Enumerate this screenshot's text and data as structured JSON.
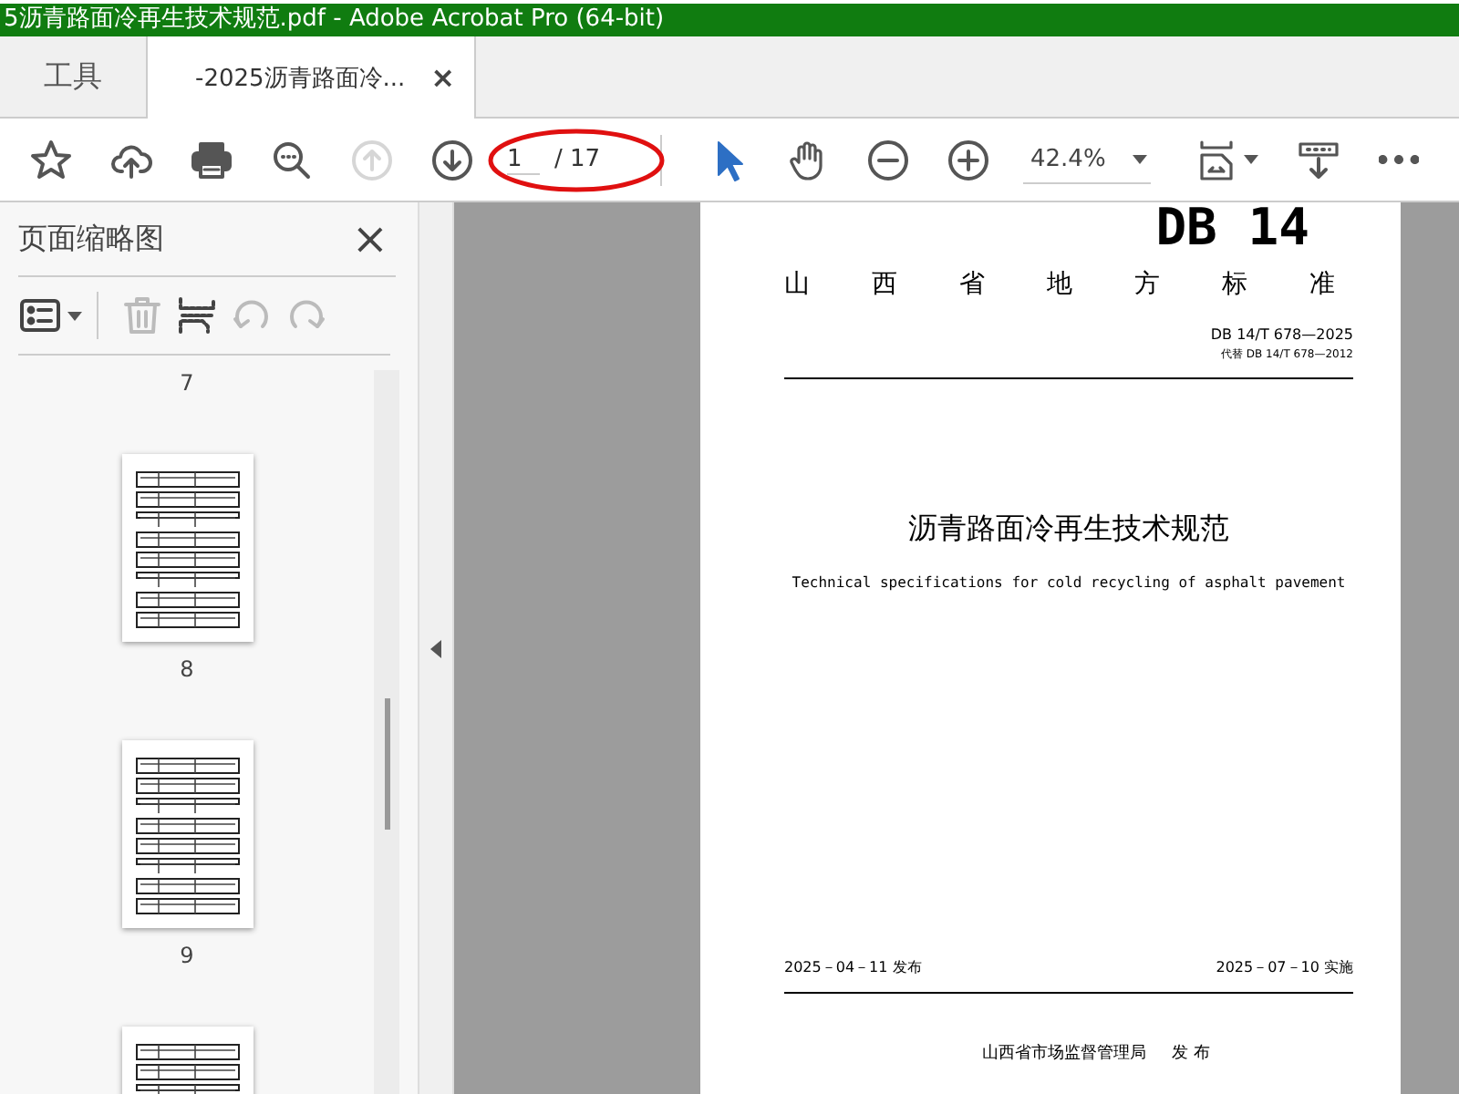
{
  "window": {
    "title": "5沥青路面冷再生技术规范.pdf - Adobe Acrobat Pro (64-bit)"
  },
  "tabs": [
    {
      "label": "工具",
      "selected": false
    },
    {
      "label": "-2025沥青路面冷...",
      "selected": true,
      "close": "×"
    }
  ],
  "toolbar": {
    "items": [
      {
        "kind": "bookmark",
        "disabled": false,
        "selected": false
      },
      {
        "kind": "upload",
        "disabled": false,
        "selected": false
      },
      {
        "kind": "print",
        "disabled": false,
        "selected": false
      },
      {
        "kind": "find",
        "disabled": false,
        "selected": false
      },
      {
        "kind": "prev",
        "disabled": true,
        "selected": false
      },
      {
        "kind": "next",
        "disabled": false,
        "selected": false
      },
      {
        "kind": "page_field",
        "value": "1",
        "total": "/ 17"
      },
      {
        "kind": "pointer",
        "disabled": false,
        "selected": true
      },
      {
        "kind": "hand",
        "disabled": false,
        "selected": false
      },
      {
        "kind": "zoom_out",
        "disabled": false,
        "selected": false
      },
      {
        "kind": "zoom_in",
        "disabled": false,
        "selected": false
      },
      {
        "kind": "zoom_field",
        "value": "42.4%"
      },
      {
        "kind": "fit",
        "disabled": false,
        "selected": false
      },
      {
        "kind": "scroll",
        "disabled": false,
        "selected": false
      },
      {
        "kind": "more",
        "disabled": false,
        "selected": false
      }
    ]
  },
  "panel": {
    "title": "页面缩略图",
    "close": "×",
    "tools": [
      {
        "kind": "options",
        "disabled": false
      },
      {
        "kind": "delete",
        "disabled": true
      },
      {
        "kind": "insert",
        "disabled": false
      },
      {
        "kind": "rotate_left",
        "disabled": true
      },
      {
        "kind": "rotate_right",
        "disabled": true
      }
    ],
    "thumbnails": [
      {
        "label": "7"
      },
      {
        "label": "8"
      },
      {
        "label": "9"
      }
    ]
  },
  "document": {
    "code": "DB 14",
    "authority": "山西省地方标准",
    "number": "DB 14/T 678—2025",
    "replaces": "代替 DB 14/T 678—2012",
    "title": "沥青路面冷再生技术规范",
    "subtitle": "Technical specifications for cold recycling of asphalt pavement",
    "issue_date": "2025－04－11 发布",
    "effective_date": "2025－07－10 实施",
    "issuer": "山西省市场监督管理局",
    "issue_word": "发 布"
  }
}
